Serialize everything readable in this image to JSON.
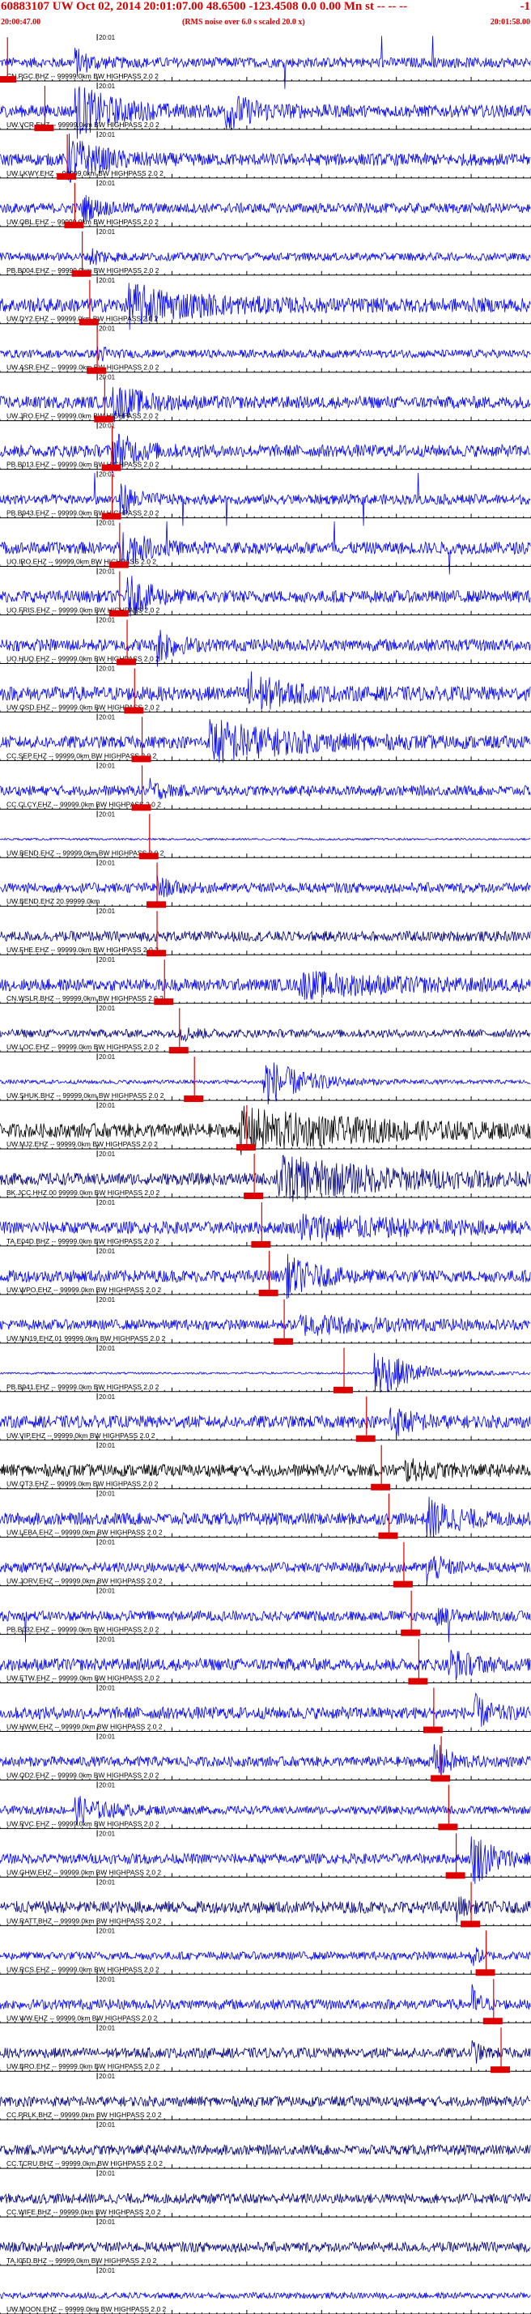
{
  "header": {
    "event_title": "60883107 UW Oct 02, 2014 20:01:07.00   48.6500 -123.4508  0.0 0.00 Mn st -- -- --",
    "title_right": "-1",
    "start_time": "20:00:47.00",
    "noise_note": "(RMS noise over 6.0 s scaled 20.0 x)",
    "end_time": "20:01:58.00"
  },
  "colors": {
    "trace": "#0000ff",
    "trace_dark": "#000080",
    "trace_black": "#000000",
    "pick": "#dd0000",
    "axis": "#000000"
  },
  "chart_data": {
    "type": "line",
    "x_unit": "time",
    "xlim": [
      "20:00:47.00",
      "20:01:58.00"
    ],
    "tick_label": "20:01",
    "tick_label_time": "20:01:00",
    "traces": [
      {
        "label": "CN.PGC.BHZ -- 99999.0km BW  HIGHPASS  2.0  2",
        "pick": "20:00:48",
        "amp": 0.25,
        "bursts": [
          {
            "t": 10,
            "a": 0.6,
            "d": 2
          }
        ],
        "spikes": true,
        "color": "blue"
      },
      {
        "label": "UW.VCR.EHZ -- 99999.0km BW  HIGHPASS  2.0  2",
        "pick": "20:00:53",
        "amp": 0.3,
        "bursts": [
          {
            "t": 10,
            "a": 1.2,
            "d": 5
          },
          {
            "t": 30,
            "a": 0.8,
            "d": 4
          }
        ],
        "color": "blue"
      },
      {
        "label": "UW.LKWY.EHZ -- 99999.0km BW  HIGHPASS  2.0  2",
        "pick": "20:00:56",
        "amp": 0.3,
        "bursts": [
          {
            "t": 9,
            "a": 1.1,
            "d": 4
          }
        ],
        "color": "blue"
      },
      {
        "label": "UW.OBL.EHZ -- 99999.0km BW  HIGHPASS  2.0  2",
        "pick": "20:00:57",
        "amp": 0.25,
        "bursts": [
          {
            "t": 11,
            "a": 0.6,
            "d": 2
          }
        ],
        "color": "blue"
      },
      {
        "label": "PB.B004.EHZ -- 99999.0km BW  HIGHPASS  2.0  2",
        "pick": "20:00:58",
        "amp": 0.2,
        "bursts": [
          {
            "t": 12,
            "a": 0.4,
            "d": 2
          }
        ],
        "color": "blue"
      },
      {
        "label": "UW.DY2.EHZ -- 99999.0km BW  HIGHPASS  2.0  2",
        "pick": "20:00:59",
        "amp": 0.35,
        "bursts": [
          {
            "t": 17,
            "a": 0.9,
            "d": 8
          }
        ],
        "color": "blue"
      },
      {
        "label": "UW.ASR.EHZ -- 99999.0km BW  HIGHPASS  2.0  2",
        "pick": "20:01:00",
        "amp": 0.2,
        "bursts": [
          {
            "t": 13,
            "a": 0.5,
            "d": 1
          }
        ],
        "color": "blue"
      },
      {
        "label": "UW.JRO.EHZ -- 99999.0km BW  HIGHPASS  2.0  2",
        "pick": "20:01:01",
        "amp": 0.3,
        "bursts": [
          {
            "t": 15,
            "a": 0.8,
            "d": 4
          }
        ],
        "color": "blue"
      },
      {
        "label": "PB.B013.EHZ -- 99999.0km BW  HIGHPASS  2.0  2",
        "pick": "20:01:02",
        "amp": 0.3,
        "bursts": [
          {
            "t": 15,
            "a": 0.9,
            "d": 3
          }
        ],
        "color": "blue"
      },
      {
        "label": "PB.B943.EHZ -- 99999.0km BW  HIGHPASS  2.0  2",
        "pick": "20:01:02",
        "amp": 0.25,
        "bursts": [
          {
            "t": 16,
            "a": 0.8,
            "d": 2
          }
        ],
        "spikes": true,
        "color": "blue"
      },
      {
        "label": "UO.IRO.EHZ -- 99999.0km BW  HIGHPASS  2.0  2",
        "pick": "20:01:03",
        "amp": 0.3,
        "bursts": [
          {
            "t": 16,
            "a": 0.9,
            "d": 3
          }
        ],
        "spikes": true,
        "color": "blue"
      },
      {
        "label": "UO.FRIS.EHZ -- 99999.0km BW  HIGHPASS  2.0  2",
        "pick": "20:01:03",
        "amp": 0.3,
        "bursts": [
          {
            "t": 17,
            "a": 0.9,
            "d": 3
          }
        ],
        "color": "blue"
      },
      {
        "label": "UO.HUQ.EHZ -- 99999.0km BW  HIGHPASS  2.0  2",
        "pick": "20:01:04",
        "amp": 0.3,
        "bursts": [
          {
            "t": 21,
            "a": 0.9,
            "d": 2
          }
        ],
        "color": "blue"
      },
      {
        "label": "UW.OSD.EHZ -- 99999.0km BW  HIGHPASS  2.0  2",
        "pick": "20:01:05",
        "amp": 0.35,
        "bursts": [
          {
            "t": 33,
            "a": 1.0,
            "d": 4
          }
        ],
        "color": "blue"
      },
      {
        "label": "CC.SEP.EHZ -- 99999.0km BW  HIGHPASS  2.0  2",
        "pick": "20:01:06",
        "amp": 0.3,
        "bursts": [
          {
            "t": 28,
            "a": 1.0,
            "d": 10
          }
        ],
        "color": "blue"
      },
      {
        "label": "CC.CLCY.EHZ -- 99999.0km BW  HIGHPASS  2.0  2",
        "pick": "20:01:06",
        "amp": 0.25,
        "bursts": [
          {
            "t": 20,
            "a": 0.4,
            "d": 2
          }
        ],
        "color": "blue"
      },
      {
        "label": "UW.BEND.EHZ -- 99999.0km BW  HIGHPASS  2.0  2",
        "pick": "20:01:07",
        "amp": 0.05,
        "bursts": [],
        "color": "blue"
      },
      {
        "label": "UW.BEND.EHZ 20.99999.0km",
        "pick": "20:01:08",
        "amp": 0.25,
        "bursts": [
          {
            "t": 21,
            "a": 0.4,
            "d": 2
          }
        ],
        "color": "blue"
      },
      {
        "label": "UW.FHE.EHZ -- 99999.0km BW  HIGHPASS  2.0  2",
        "pick": "20:01:08",
        "amp": 0.25,
        "bursts": [],
        "color": "dark"
      },
      {
        "label": "CN.WSLR.BHZ -- 99999.0km BW  HIGHPASS  2.0  2",
        "pick": "20:01:09",
        "amp": 0.3,
        "bursts": [
          {
            "t": 40,
            "a": 0.5,
            "d": 12
          }
        ],
        "color": "blue"
      },
      {
        "label": "UW.LOC.EHZ -- 99999.0km BW  HIGHPASS  2.0  2",
        "pick": "20:01:11",
        "amp": 0.2,
        "bursts": [
          {
            "t": 24,
            "a": 0.3,
            "d": 2
          }
        ],
        "color": "dark"
      },
      {
        "label": "UW.SHUK.BHZ -- 99999.0km BW  HIGHPASS  2.0  2",
        "pick": "20:01:13",
        "amp": 0.1,
        "bursts": [
          {
            "t": 35,
            "a": 1.3,
            "d": 5
          }
        ],
        "color": "blue"
      },
      {
        "label": "UW.MJ2.EHZ -- 99999.0km BW  HIGHPASS  2.0  2",
        "pick": "20:01:20",
        "amp": 0.35,
        "bursts": [
          {
            "t": 32,
            "a": 0.9,
            "d": 15
          }
        ],
        "color": "black"
      },
      {
        "label": "BK.JCC.HHZ.00 99999.0km BW  HIGHPASS  2.0  2",
        "pick": "20:01:21",
        "amp": 0.3,
        "bursts": [
          {
            "t": 37,
            "a": 1.0,
            "d": 14
          }
        ],
        "color": "dark"
      },
      {
        "label": "TA.E04D.BHZ -- 99999.0km BW  HIGHPASS  2.0  2",
        "pick": "20:01:22",
        "amp": 0.3,
        "bursts": [
          {
            "t": 40,
            "a": 0.5,
            "d": 15
          }
        ],
        "color": "blue"
      },
      {
        "label": "UW.WPO.EHZ -- 99999.0km BW  HIGHPASS  2.0  2",
        "pick": "20:01:23",
        "amp": 0.3,
        "bursts": [
          {
            "t": 38,
            "a": 0.9,
            "d": 4
          }
        ],
        "color": "blue"
      },
      {
        "label": "UW.NN19.EHZ.01 99999.0km BW  HIGHPASS  2.0  2",
        "pick": "20:01:25",
        "amp": 0.25,
        "bursts": [
          {
            "t": 40,
            "a": 0.4,
            "d": 10
          }
        ],
        "color": "blue"
      },
      {
        "label": "PB.B941.EHZ -- 99999.0km BW  HIGHPASS  2.0  2",
        "pick": "20:01:33",
        "amp": 0.05,
        "bursts": [
          {
            "t": 50,
            "a": 1.3,
            "d": 5
          }
        ],
        "color": "blue"
      },
      {
        "label": "UW.VIP.EHZ -- 99999.0km BW  HIGHPASS  2.0  2",
        "pick": "20:01:36",
        "amp": 0.3,
        "bursts": [
          {
            "t": 52,
            "a": 0.7,
            "d": 3
          }
        ],
        "color": "blue"
      },
      {
        "label": "UW.OT3.EHZ -- 99999.0km BW  HIGHPASS  2.0  2",
        "pick": "20:01:38",
        "amp": 0.3,
        "bursts": [
          {
            "t": 54,
            "a": 0.4,
            "d": 4
          }
        ],
        "color": "black"
      },
      {
        "label": "UW.LEBA.EHZ -- 99999.0km BW  HIGHPASS  2.0  2",
        "pick": "20:01:39",
        "amp": 0.3,
        "bursts": [
          {
            "t": 57,
            "a": 0.9,
            "d": 4
          }
        ],
        "color": "blue"
      },
      {
        "label": "UW.JORV.EHZ -- 99999.0km BW  HIGHPASS  2.0  2",
        "pick": "20:01:41",
        "amp": 0.25,
        "bursts": [
          {
            "t": 57,
            "a": 0.8,
            "d": 2
          }
        ],
        "color": "blue"
      },
      {
        "label": "PB.B032.EHZ -- 99999.0km BW  HIGHPASS  2.0  2",
        "pick": "20:01:42",
        "amp": 0.25,
        "bursts": [
          {
            "t": 58,
            "a": 0.4,
            "d": 2
          }
        ],
        "spikes": true,
        "color": "blue"
      },
      {
        "label": "UW.ETW.EHZ -- 99999.0km BW  HIGHPASS  2.0  2",
        "pick": "20:01:43",
        "amp": 0.3,
        "bursts": [
          {
            "t": 60,
            "a": 0.7,
            "d": 3
          }
        ],
        "color": "blue"
      },
      {
        "label": "UW.HWW.EHZ -- 99999.0km BW  HIGHPASS  2.0  2",
        "pick": "20:01:45",
        "amp": 0.3,
        "bursts": [
          {
            "t": 63,
            "a": 0.9,
            "d": 2
          }
        ],
        "color": "blue"
      },
      {
        "label": "UW.OD2.EHZ -- 99999.0km BW  HIGHPASS  2.0  2",
        "pick": "20:01:46",
        "amp": 0.25,
        "bursts": [
          {
            "t": 58,
            "a": 0.9,
            "d": 2
          }
        ],
        "color": "blue"
      },
      {
        "label": "UW.RVC.EHZ -- 99999.0km BW  HIGHPASS  2.0  2",
        "pick": "20:01:47",
        "amp": 0.2,
        "bursts": [
          {
            "t": 10,
            "a": 0.6,
            "d": 4
          }
        ],
        "color": "blue"
      },
      {
        "label": "UW.GHW.EHZ -- 99999.0km BW  HIGHPASS  2.0  2",
        "pick": "20:01:48",
        "amp": 0.25,
        "bursts": [
          {
            "t": 63,
            "a": 1.3,
            "d": 3
          }
        ],
        "color": "blue"
      },
      {
        "label": "UW.RATT.BHZ -- 99999.0km BW  HIGHPASS  2.0  2",
        "pick": "20:01:50",
        "amp": 0.3,
        "bursts": [
          {
            "t": 61,
            "a": 0.5,
            "d": 1
          }
        ],
        "color": "dark"
      },
      {
        "label": "UW.RCS.EHZ -- 99999.0km BW  HIGHPASS  2.0  2",
        "pick": "20:01:52",
        "amp": 0.2,
        "bursts": [
          {
            "t": 63,
            "a": 0.5,
            "d": 1
          }
        ],
        "color": "blue"
      },
      {
        "label": "UW.WW.EHZ -- 99999.0km BW  HIGHPASS  2.0  2",
        "pick": "20:01:53",
        "amp": 0.25,
        "bursts": [
          {
            "t": 63,
            "a": 0.9,
            "d": 1
          }
        ],
        "color": "blue"
      },
      {
        "label": "UW.BRO.EHZ -- 99999.0km BW  HIGHPASS  2.0  2",
        "pick": "20:01:54",
        "amp": 0.25,
        "bursts": [
          {
            "t": 63,
            "a": 0.6,
            "d": 1
          }
        ],
        "color": "dark"
      },
      {
        "label": "CC.PRLK.BHZ -- 99999.0km BW  HIGHPASS  2.0  2",
        "pick": "",
        "amp": 0.25,
        "bursts": [],
        "color": "dark"
      },
      {
        "label": "CC.TCRU.BHZ -- 99999.0km BW  HIGHPASS  2.0  2",
        "pick": "",
        "amp": 0.25,
        "bursts": [],
        "color": "dark"
      },
      {
        "label": "CC.WIFE.BHZ -- 99999.0km BW  HIGHPASS  2.0  2",
        "pick": "",
        "amp": 0.25,
        "bursts": [],
        "color": "dark"
      },
      {
        "label": "TA.I05D.BHZ -- 99999.0km BW  HIGHPASS  2.0  2",
        "pick": "",
        "amp": 0.25,
        "bursts": [],
        "color": "dark"
      },
      {
        "label": "UW.MOON.EHZ -- 99999.0km BW  HIGHPASS  2.0  2",
        "pick": "",
        "amp": 0.15,
        "bursts": [],
        "color": "blue"
      }
    ]
  }
}
